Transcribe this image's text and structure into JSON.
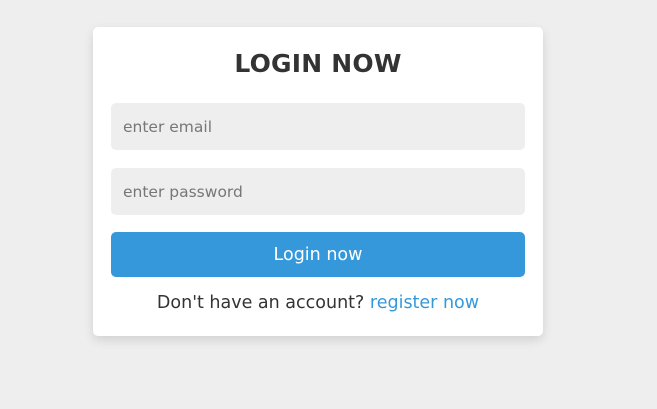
{
  "login_form": {
    "title": "LOGIN NOW",
    "email_placeholder": "enter email",
    "email_value": "",
    "password_placeholder": "enter password",
    "password_value": "",
    "submit_label": "Login now",
    "footer_text": "Don't have an account? ",
    "register_link": "register now"
  },
  "colors": {
    "page_background": "#eeeeee",
    "card_background": "#ffffff",
    "input_background": "#eeeeee",
    "accent": "#3498db",
    "text": "#333333"
  }
}
